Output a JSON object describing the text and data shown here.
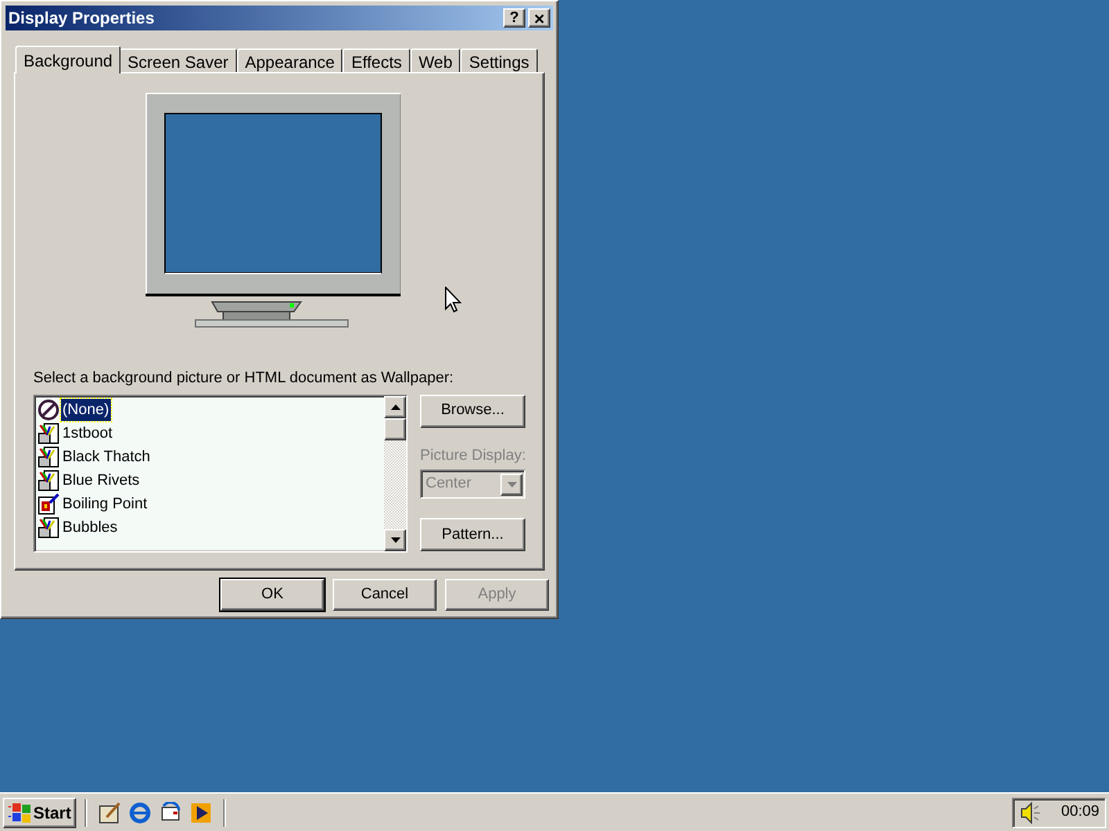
{
  "window": {
    "title": "Display Properties",
    "help_button": "?",
    "close_button": "×"
  },
  "tabs": [
    {
      "label": "Background",
      "selected": true
    },
    {
      "label": "Screen Saver",
      "selected": false
    },
    {
      "label": "Appearance",
      "selected": false
    },
    {
      "label": "Effects",
      "selected": false
    },
    {
      "label": "Web",
      "selected": false
    },
    {
      "label": "Settings",
      "selected": false
    }
  ],
  "wallpaper_label": "Select a background picture or HTML document as Wallpaper:",
  "wallpapers": [
    {
      "name": "(None)",
      "kind": "none",
      "selected": true
    },
    {
      "name": "1stboot",
      "kind": "html",
      "selected": false
    },
    {
      "name": "Black Thatch",
      "kind": "html",
      "selected": false
    },
    {
      "name": "Blue Rivets",
      "kind": "html",
      "selected": false
    },
    {
      "name": "Boiling Point",
      "kind": "bitmap",
      "selected": false
    },
    {
      "name": "Bubbles",
      "kind": "html",
      "selected": false
    }
  ],
  "browse_button": "Browse...",
  "picture_display": {
    "label": "Picture Display:",
    "value": "Center",
    "disabled": true
  },
  "pattern_button": "Pattern...",
  "buttons": [
    {
      "label": "OK",
      "disabled": false,
      "default": true
    },
    {
      "label": "Cancel",
      "disabled": false,
      "default": false
    },
    {
      "label": "Apply",
      "disabled": true,
      "default": false
    }
  ],
  "taskbar": {
    "start": "Start",
    "clock": "00:09"
  }
}
